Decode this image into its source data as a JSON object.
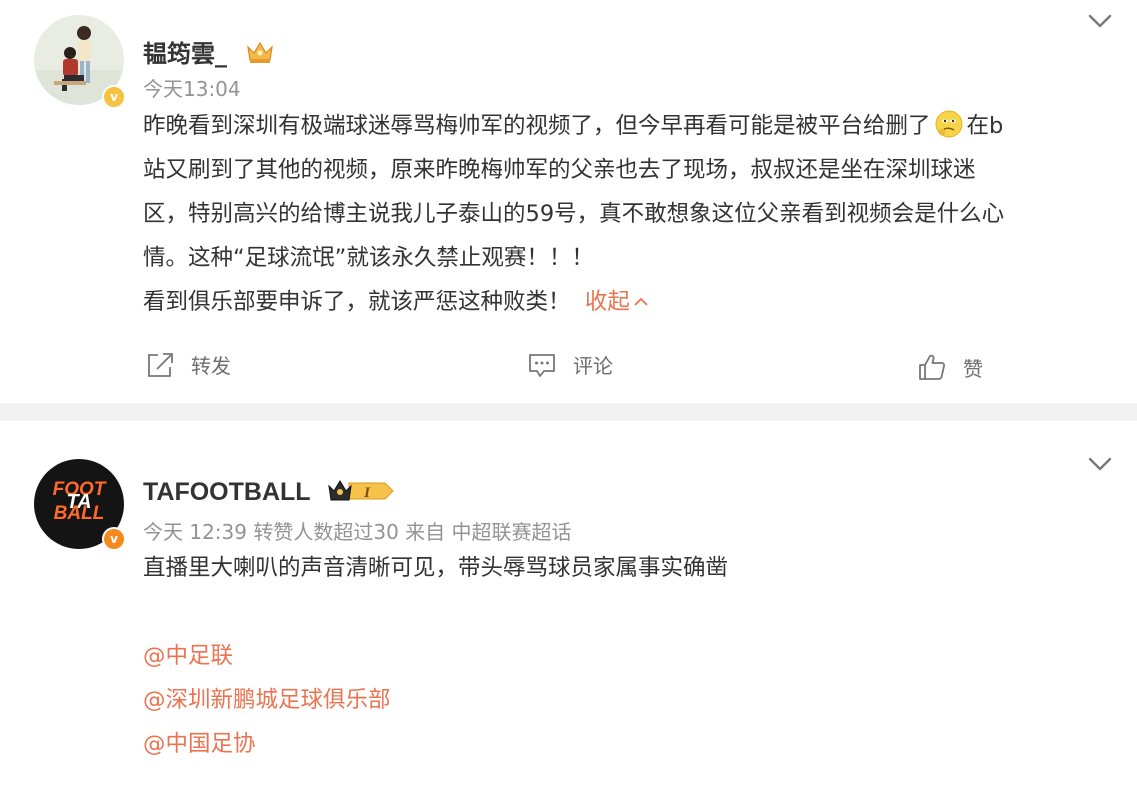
{
  "post1": {
    "username": "韫筠雲_",
    "timestamp": "今天13:04",
    "text_line1_a": "昨晚看到深圳有极端球迷辱骂梅帅军的视频了，但今早再看可能是被平台给删了",
    "text_line1_b": "在b",
    "text_line2": "站又刷到了其他的视频，原来昨晚梅帅军的父亲也去了现场，叔叔还是坐在深圳球迷",
    "text_line3": "区，特别高兴的给博主说我儿子泰山的59号，真不敢想象这位父亲看到视频会是什么心",
    "text_line4": "情。这种“足球流氓”就该永久禁止观赛！！！",
    "text_line5": "看到俱乐部要申诉了，就该严惩这种败类！",
    "collapse_label": "收起",
    "actions": {
      "forward": "转发",
      "comment": "评论",
      "like": "赞"
    }
  },
  "post2": {
    "username": "TAFOOTBALL",
    "avatar_text_top": "FOOT",
    "avatar_text_mid": "TA",
    "avatar_text_bottom": "BALL",
    "meta": "今天 12:39 转赞人数超过30  来自 中超联赛超话",
    "text": "直播里大喇叭的声音清晰可见，带头辱骂球员家属事实确凿",
    "mentions": [
      "@中足联",
      "@深圳新鹏城足球俱乐部",
      "@中国足协"
    ]
  },
  "colors": {
    "accent": "#eb7350",
    "meta_gray": "#939393",
    "verified_gold": "#f5c340",
    "verified_orange": "#f48a1d"
  }
}
